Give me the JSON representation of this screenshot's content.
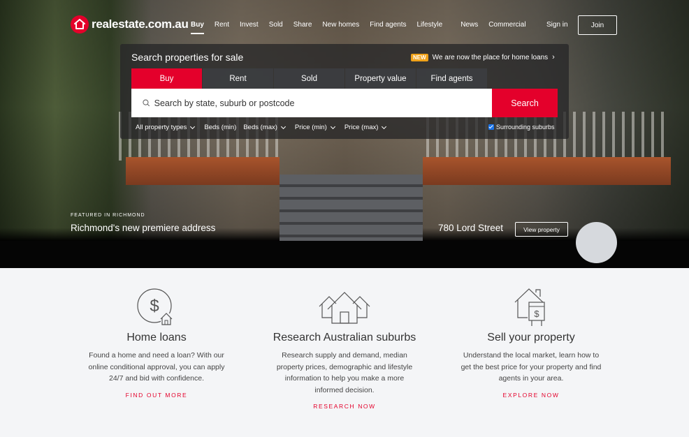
{
  "brand": {
    "logo_text": "realestate.com.au",
    "accent": "#e4002b"
  },
  "nav": {
    "links": [
      "Buy",
      "Rent",
      "Invest",
      "Sold",
      "Share",
      "New homes",
      "Find agents",
      "Lifestyle",
      "News",
      "Commercial"
    ],
    "active": "Buy",
    "sign_in": "Sign in",
    "join": "Join"
  },
  "search_panel": {
    "title": "Search properties for sale",
    "promo_badge": "NEW",
    "promo_text": "We are now the place for home loans",
    "tabs": [
      "Buy",
      "Rent",
      "Sold",
      "Property value",
      "Find agents"
    ],
    "active_tab": "Buy",
    "input_placeholder": "Search by state, suburb or postcode",
    "search_button": "Search",
    "filters": [
      "All property types",
      "Beds (min)",
      "Beds (max)",
      "Price (min)",
      "Price (max)"
    ],
    "surrounding_label": "Surrounding suburbs",
    "surrounding_checked": true
  },
  "featured": {
    "eyebrow": "FEATURED IN RICHMOND",
    "title": "Richmond's new premiere address",
    "address": "780 Lord Street",
    "cta": "View property"
  },
  "cards": [
    {
      "icon": "dollar-house-icon",
      "title": "Home loans",
      "desc": "Found a home and need a loan? With our online conditional approval, you can apply 24/7 and bid with confidence.",
      "link": "FIND OUT MORE"
    },
    {
      "icon": "houses-icon",
      "title": "Research Australian suburbs",
      "desc": "Research supply and demand, median property prices, demographic and lifestyle information to help you make a more informed decision.",
      "link": "RESEARCH NOW"
    },
    {
      "icon": "house-sale-sign-icon",
      "title": "Sell your property",
      "desc": "Understand the local market, learn how to get the best price for your property and find agents in your area.",
      "link": "EXPLORE NOW"
    }
  ]
}
